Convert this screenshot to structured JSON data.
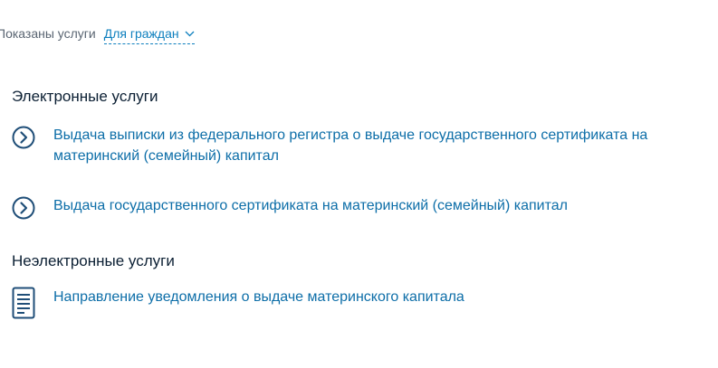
{
  "filter": {
    "label": "Показаны услуги",
    "selected": "Для граждан"
  },
  "sections": [
    {
      "title": "Электронные услуги",
      "items": [
        {
          "label": "Выдача выписки из федерального регистра о выдаче государственного сертификата на материнский (семейный) капитал",
          "icon": "chevron-right-circle-icon"
        },
        {
          "label": "Выдача государственного сертификата на материнский (семейный) капитал",
          "icon": "chevron-right-circle-icon"
        }
      ]
    },
    {
      "title": "Неэлектронные услуги",
      "items": [
        {
          "label": "Направление уведомления о выдаче материнского капитала",
          "icon": "document-icon"
        }
      ]
    }
  ],
  "colors": {
    "link": "#0d6ea8",
    "accent": "#0d7fbe",
    "icon": "#1f4e78",
    "text": "#0b1f33",
    "muted": "#5a6572"
  }
}
